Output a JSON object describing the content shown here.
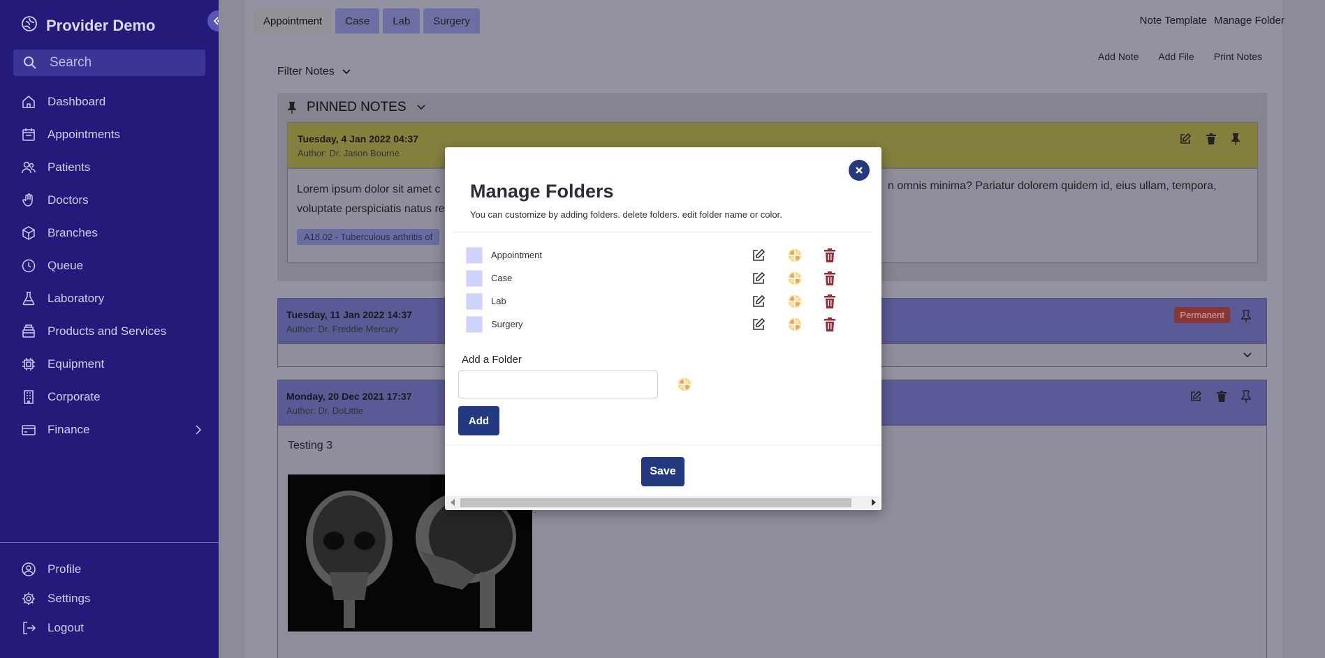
{
  "sidebar": {
    "brand": "Provider Demo",
    "search_placeholder": "Search",
    "items": [
      {
        "label": "Dashboard"
      },
      {
        "label": "Appointments"
      },
      {
        "label": "Patients"
      },
      {
        "label": "Doctors"
      },
      {
        "label": "Branches"
      },
      {
        "label": "Queue"
      },
      {
        "label": "Laboratory"
      },
      {
        "label": "Products and Services"
      },
      {
        "label": "Equipment"
      },
      {
        "label": "Corporate"
      },
      {
        "label": "Finance"
      }
    ],
    "bottom": [
      {
        "label": "Profile"
      },
      {
        "label": "Settings"
      },
      {
        "label": "Logout"
      }
    ]
  },
  "header": {
    "tabs": [
      "Appointment",
      "Case",
      "Lab",
      "Surgery"
    ],
    "links": [
      "Note Template",
      "Manage Folder"
    ],
    "actions": [
      "Add Note",
      "Add File",
      "Print Notes"
    ],
    "filter": "Filter Notes"
  },
  "pinned": {
    "heading": "PINNED NOTES",
    "note": {
      "date": "Tuesday, 4 Jan 2022 04:37",
      "author": "Author: Dr. Jason Bourne",
      "body_left": "Lorem ipsum dolor sit amet c",
      "body_left2": "voluptate perspiciatis natus re",
      "body_right": "n omnis minima? Pariatur dolorem quidem id, eius ullam, tempora,",
      "tag": "A18.02 - Tuberculous arthritis of"
    }
  },
  "note2": {
    "date": "Tuesday, 11 Jan 2022 14:37",
    "author": "Author: Dr. Freddie Mercury",
    "badge": "Permanent"
  },
  "note3": {
    "date": "Monday, 20 Dec 2021 17:37",
    "author": "Author: Dr. DoLittle",
    "body": "Testing 3"
  },
  "modal": {
    "title": "Manage Folders",
    "subtitle": "You can customize by adding folders. delete folders. edit folder name or color.",
    "folders": [
      {
        "name": "Appointment",
        "color": "#cdd3fb"
      },
      {
        "name": "Case",
        "color": "#cdd3fb"
      },
      {
        "name": "Lab",
        "color": "#cdd3fb"
      },
      {
        "name": "Surgery",
        "color": "#cdd3fb"
      }
    ],
    "add_label": "Add a Folder",
    "add_value": "",
    "add_button": "Add",
    "save_button": "Save"
  },
  "colors": {
    "sidebar": "#241a7a",
    "primary_button": "#233a80",
    "delete_icon": "#a0282e",
    "folder_swatch": "#cdd3fb"
  }
}
